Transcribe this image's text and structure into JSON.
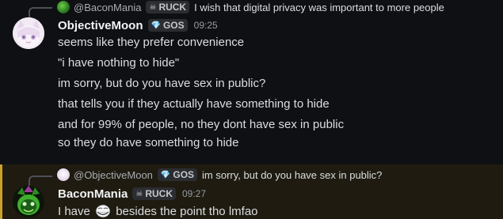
{
  "message1": {
    "reply": {
      "author": "@BaconMania",
      "tag": "RUCK",
      "text": "I wish that digital privacy was important to more people"
    },
    "author": "ObjectiveMoon",
    "tag": "GOS",
    "time": "09:25",
    "lines": [
      "seems like they prefer convenience",
      "\"i have nothing to hide\"",
      "im sorry, but do you have sex in public?",
      "that tells you if they actually have something to hide",
      "and for 99% of people, no they dont have sex in public",
      "so they do have something to hide"
    ]
  },
  "message2": {
    "reply": {
      "author": "@ObjectiveMoon",
      "tag": "GOS",
      "text": "im sorry, but do you have sex in public?"
    },
    "author": "BaconMania",
    "tag": "RUCK",
    "time": "09:27",
    "text_before": "I have",
    "emoji": "trollface-emoji",
    "text_after": "besides the point tho lmfao"
  },
  "colors": {
    "background": "#0f1013",
    "highlight_background": "#1f1b10",
    "highlight_border": "#c9a227",
    "text": "#dbdee1",
    "muted": "#949ba4"
  }
}
